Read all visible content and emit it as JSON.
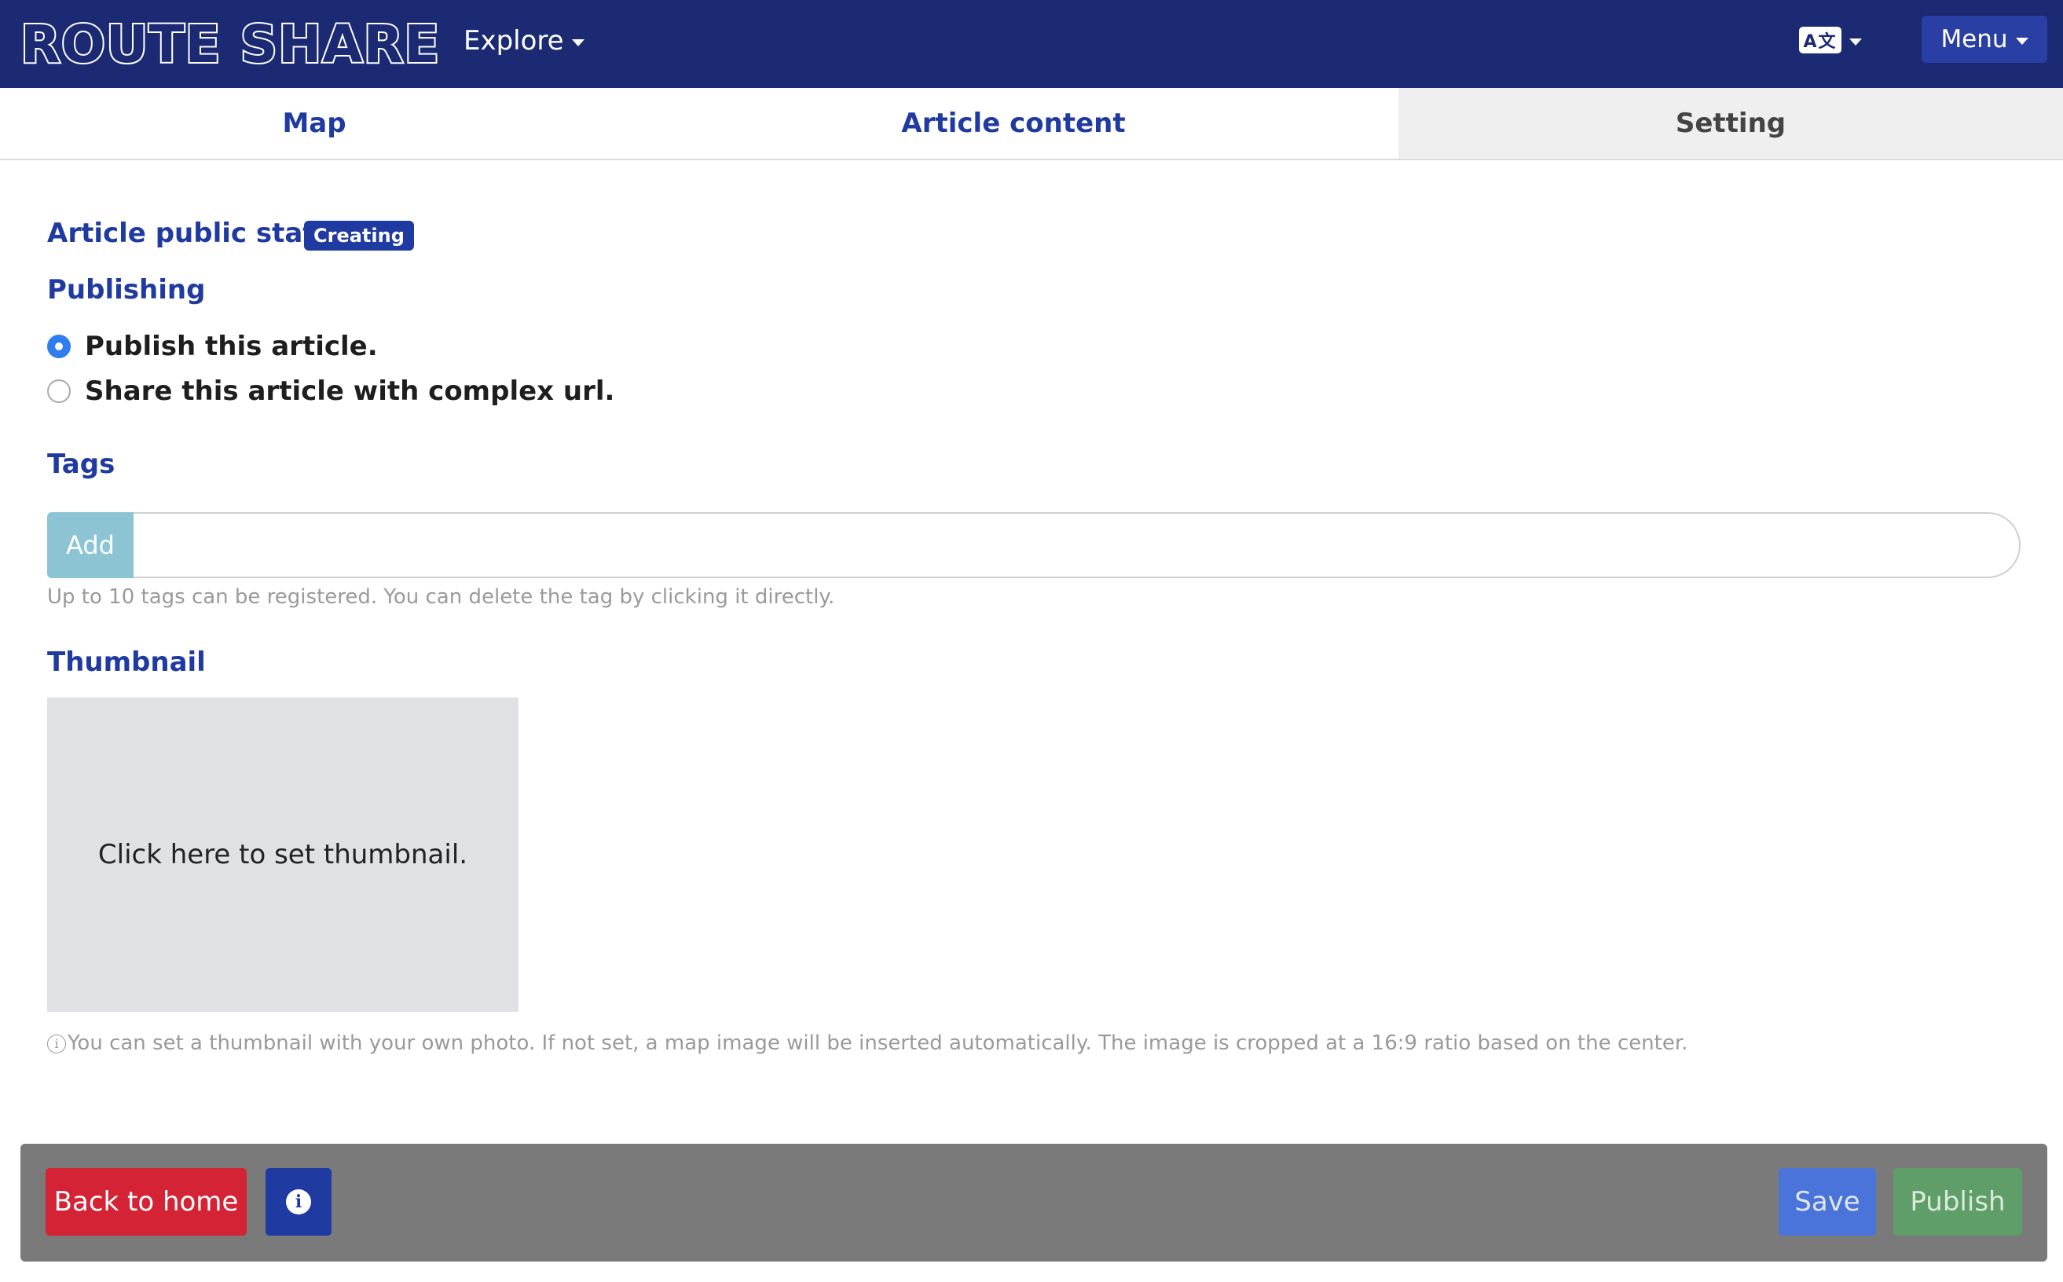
{
  "header": {
    "logo": "ROUTE SHARE",
    "explore_label": "Explore",
    "lang_icon_text": "A文",
    "menu_label": "Menu"
  },
  "tabs": [
    {
      "label": "Map"
    },
    {
      "label": "Article content"
    },
    {
      "label": "Setting",
      "active": true
    }
  ],
  "settings": {
    "public_status_label": "Article public status",
    "status_badge": "Creating",
    "publishing_label": "Publishing",
    "publishing_options": [
      {
        "label": "Publish this article.",
        "selected": true
      },
      {
        "label": "Share this article with complex url.",
        "selected": false
      }
    ],
    "tags_label": "Tags",
    "tags_add_label": "Add",
    "tags_input_value": "",
    "tags_help": "Up to 10 tags can be registered. You can delete the tag by clicking it directly.",
    "thumbnail_label": "Thumbnail",
    "thumbnail_placeholder": "Click here to set thumbnail.",
    "thumbnail_help": "You can set a thumbnail with your own photo. If not set, a map image will be inserted automatically. The image is cropped at a 16:9 ratio based on the center."
  },
  "footer": {
    "back_label": "Back to home",
    "save_label": "Save",
    "publish_label": "Publish"
  },
  "colors": {
    "navbar": "#1b2a73",
    "accent": "#1f3aa0",
    "danger": "#d42335",
    "save": "#4a74d9",
    "publish": "#5f9e69"
  }
}
